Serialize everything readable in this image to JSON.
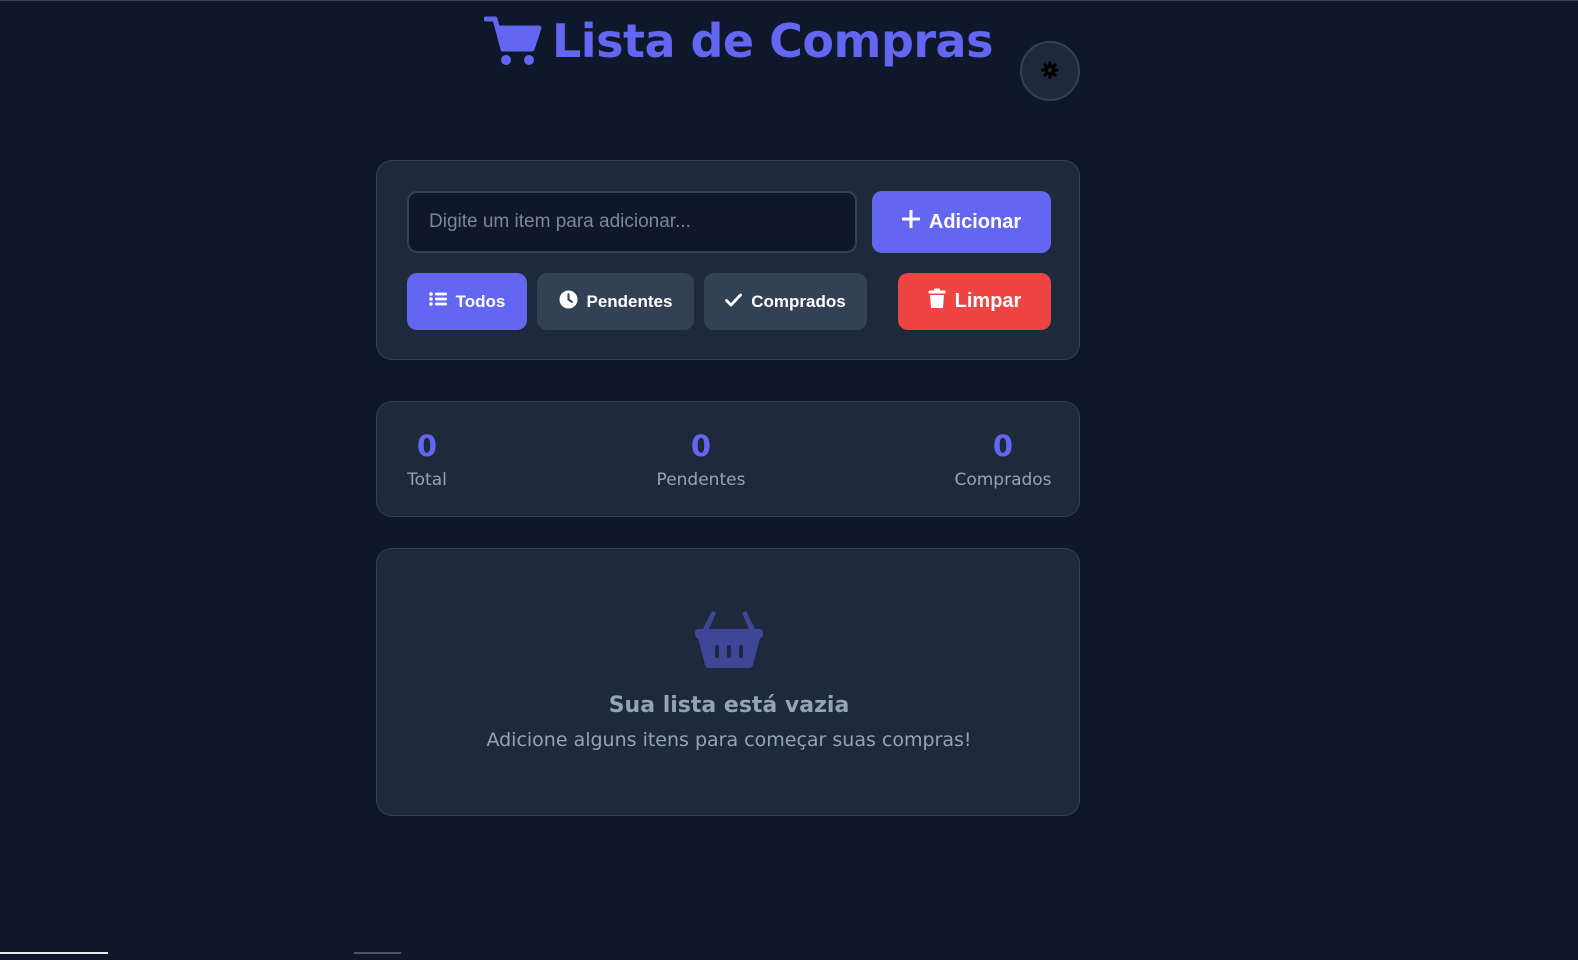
{
  "header": {
    "title": "Lista de Compras",
    "icon": "shopping-cart-icon",
    "theme_toggle_icon": "gear-icon"
  },
  "form": {
    "placeholder": "Digite um item para adicionar...",
    "value": "",
    "add_label": "Adicionar",
    "add_icon": "plus-icon"
  },
  "filters": [
    {
      "label": "Todos",
      "icon": "list-icon",
      "active": true
    },
    {
      "label": "Pendentes",
      "icon": "clock-icon",
      "active": false
    },
    {
      "label": "Comprados",
      "icon": "check-icon",
      "active": false
    }
  ],
  "clear": {
    "label": "Limpar",
    "icon": "trash-icon"
  },
  "stats": {
    "total": {
      "value": "0",
      "label": "Total"
    },
    "pending": {
      "value": "0",
      "label": "Pendentes"
    },
    "bought": {
      "value": "0",
      "label": "Comprados"
    }
  },
  "empty_state": {
    "icon": "basket-icon",
    "title": "Sua lista está vazia",
    "subtitle": "Adicione alguns itens para começar suas compras!"
  },
  "colors": {
    "background": "#0f172a",
    "card": "#1e293b",
    "accent": "#6366f1",
    "danger": "#ef4444",
    "muted_text": "#94a3b8"
  }
}
